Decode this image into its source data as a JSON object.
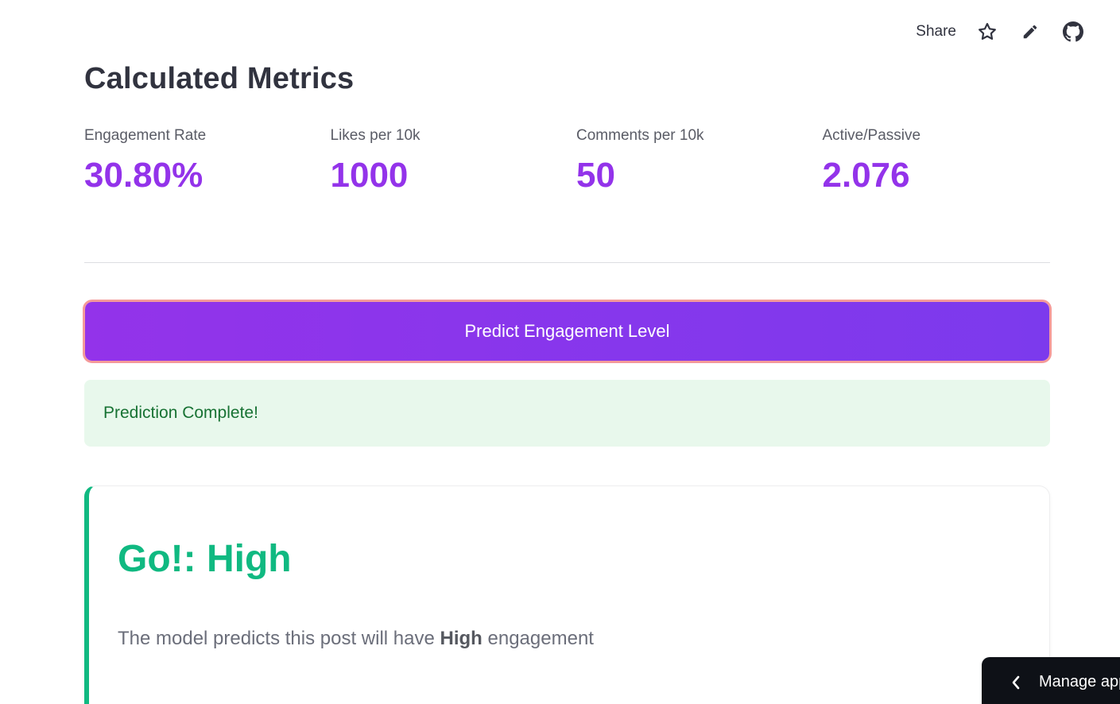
{
  "toolbar": {
    "share_label": "Share",
    "icons": [
      "star-icon",
      "pencil-icon",
      "github-icon"
    ]
  },
  "page": {
    "title": "Calculated Metrics"
  },
  "metrics": [
    {
      "label": "Engagement Rate",
      "value": "30.80%"
    },
    {
      "label": "Likes per 10k",
      "value": "1000"
    },
    {
      "label": "Comments per 10k",
      "value": "50"
    },
    {
      "label": "Active/Passive",
      "value": "2.076"
    }
  ],
  "predict_button": {
    "label": "Predict Engagement Level"
  },
  "alert": {
    "message": "Prediction Complete!"
  },
  "result": {
    "title": "Go!: High",
    "desc_prefix": "The model predicts this post will have ",
    "desc_level": "High",
    "desc_suffix": " engagement"
  },
  "manage_app": {
    "label": "Manage app"
  },
  "colors": {
    "accent_purple": "#9333ea",
    "button_gradient_end": "#7c3aed",
    "success_green": "#10b981",
    "alert_bg": "#e8f8ec",
    "alert_text": "#177233"
  }
}
